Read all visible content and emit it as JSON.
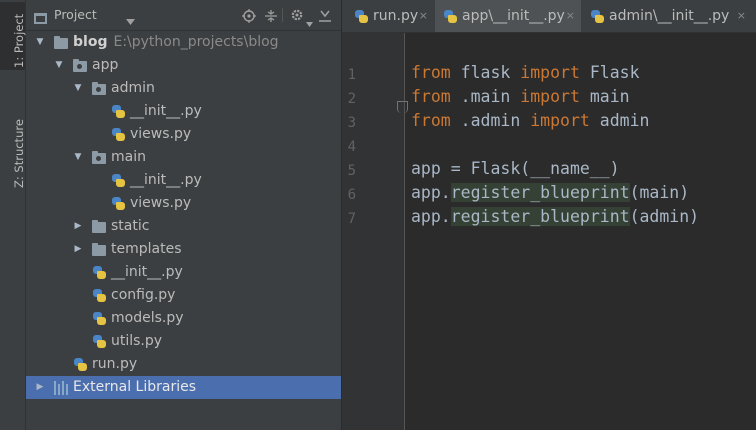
{
  "toolstrip": {
    "project_tab": "1: Project",
    "structure_tab": "Z: Structure"
  },
  "project_panel": {
    "title": "Project",
    "dropdown_icon": "chevron-down-icon",
    "tools": [
      "locate-icon",
      "collapse-icon",
      "gear-icon",
      "hide-icon"
    ],
    "tree": [
      {
        "label": "blog",
        "extra": "E:\\python_projects\\blog",
        "depth": 0,
        "kind": "folder",
        "expanded": true,
        "bold": true
      },
      {
        "label": "app",
        "depth": 1,
        "kind": "package",
        "expanded": true
      },
      {
        "label": "admin",
        "depth": 2,
        "kind": "package",
        "expanded": true
      },
      {
        "label": "__init__.py",
        "depth": 3,
        "kind": "python"
      },
      {
        "label": "views.py",
        "depth": 3,
        "kind": "python"
      },
      {
        "label": "main",
        "depth": 2,
        "kind": "package",
        "expanded": true
      },
      {
        "label": "__init__.py",
        "depth": 3,
        "kind": "python"
      },
      {
        "label": "views.py",
        "depth": 3,
        "kind": "python"
      },
      {
        "label": "static",
        "depth": 2,
        "kind": "folder",
        "expanded": false
      },
      {
        "label": "templates",
        "depth": 2,
        "kind": "folder",
        "expanded": false
      },
      {
        "label": "__init__.py",
        "depth": 2,
        "kind": "python"
      },
      {
        "label": "config.py",
        "depth": 2,
        "kind": "python"
      },
      {
        "label": "models.py",
        "depth": 2,
        "kind": "python"
      },
      {
        "label": "utils.py",
        "depth": 2,
        "kind": "python"
      },
      {
        "label": "run.py",
        "depth": 1,
        "kind": "python"
      },
      {
        "label": "External Libraries",
        "depth": 0,
        "kind": "library",
        "expanded": false,
        "selected": true
      }
    ]
  },
  "editor": {
    "tabs": [
      {
        "label": "run.py",
        "active": false
      },
      {
        "label": "app\\__init__.py",
        "active": true
      },
      {
        "label": "admin\\__init__.py",
        "active": false
      }
    ],
    "close_glyph": "×",
    "line_numbers": [
      "1",
      "2",
      "3",
      "4",
      "5",
      "6",
      "7"
    ],
    "lines": [
      [
        {
          "t": "from",
          "c": "kw"
        },
        {
          "t": " flask "
        },
        {
          "t": "import",
          "c": "kw"
        },
        {
          "t": " Flask"
        }
      ],
      [
        {
          "t": "from",
          "c": "kw"
        },
        {
          "t": " .main "
        },
        {
          "t": "import",
          "c": "kw"
        },
        {
          "t": " main"
        }
      ],
      [
        {
          "t": "from",
          "c": "kw"
        },
        {
          "t": " .admin "
        },
        {
          "t": "import",
          "c": "kw"
        },
        {
          "t": " admin"
        }
      ],
      [],
      [
        {
          "t": "app = Flask(__name__)"
        }
      ],
      [
        {
          "t": "app."
        },
        {
          "t": "register_blueprint",
          "c": "hl"
        },
        {
          "t": "(main)"
        }
      ],
      [
        {
          "t": "app."
        },
        {
          "t": "register_blueprint",
          "c": "hl"
        },
        {
          "t": "(admin)"
        }
      ]
    ]
  },
  "colors": {
    "panel_bg": "#3c3f41",
    "editor_bg": "#2b2b2b",
    "selection": "#4b6eaf",
    "keyword": "#cc7832",
    "code_text": "#a9b7c6"
  }
}
